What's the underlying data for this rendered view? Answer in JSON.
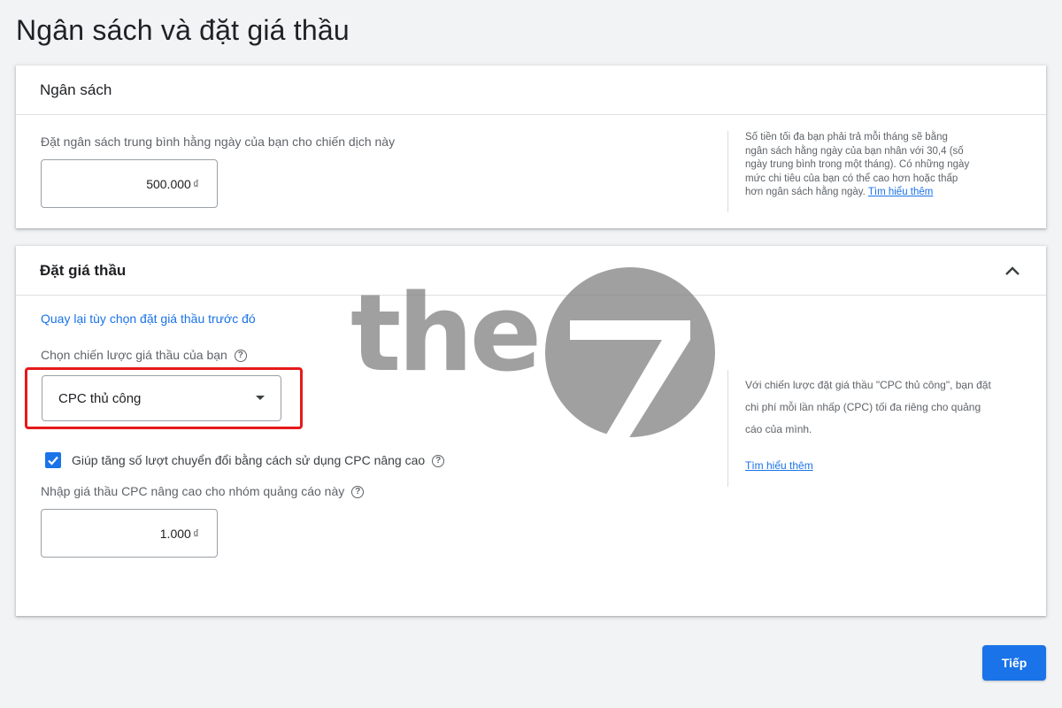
{
  "page": {
    "title": "Ngân sách và đặt giá thầu"
  },
  "budget": {
    "header": "Ngân sách",
    "label": "Đặt ngân sách trung bình hằng ngày của bạn cho chiến dịch này",
    "value": "500.000",
    "currency": "₫",
    "help_lines": [
      "Số tiền tối đa bạn phải trả mỗi tháng sẽ bằng",
      "ngân sách hằng ngày của bạn nhân với 30,4 (số",
      "ngày trung bình trong một tháng). Có những ngày",
      "mức chi tiêu của bạn có thể cao hơn hoặc thấp",
      "hơn ngân sách hằng ngày."
    ],
    "help_link": "Tìm hiểu thêm"
  },
  "bidding": {
    "header": "Đặt giá thầu",
    "back_link": "Quay lại tùy chọn đặt giá thầu trước đó",
    "strategy_label": "Chọn chiến lược giá thầu của bạn",
    "strategy_value": "CPC thủ công",
    "ecpc_label": "Giúp tăng số lượt chuyển đổi bằng cách sử dụng CPC nâng cao",
    "ecpc_checked": true,
    "bid_label": "Nhập giá thầu CPC nâng cao cho nhóm quảng cáo này",
    "bid_value": "1.000",
    "currency": "₫",
    "help_lines": [
      "Với chiến lược đặt giá thầu \"CPC thủ công\", bạn đặt",
      "chi phí mỗi lần nhấp (CPC) tối đa riêng cho quảng",
      "cáo của mình."
    ],
    "help_link": "Tìm hiểu thêm",
    "help_symbol": "?"
  },
  "footer": {
    "next_label": "Tiếp"
  },
  "watermark": {
    "text": "the"
  },
  "colors": {
    "accent": "#1a73e8",
    "highlight": "#e5191b",
    "background": "#f1f3f4"
  }
}
